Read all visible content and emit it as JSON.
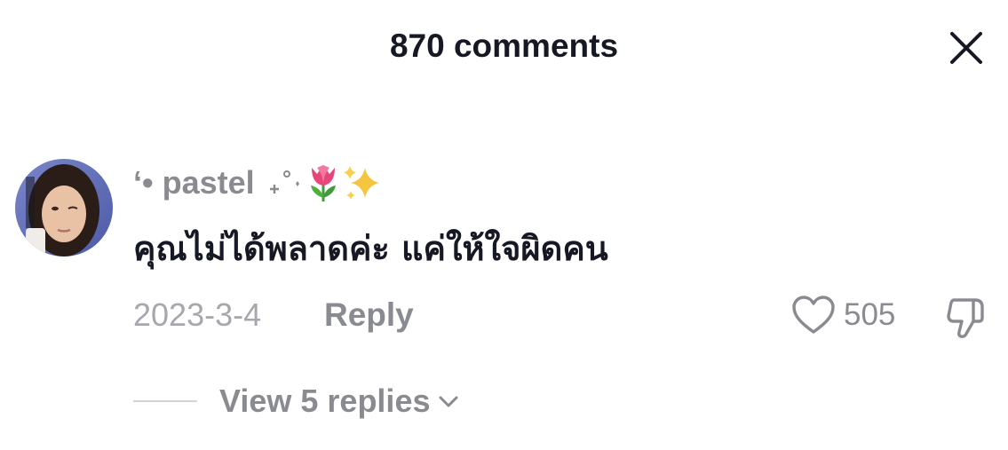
{
  "header": {
    "title": "870 comments"
  },
  "comment": {
    "username": "‘• pastel",
    "username_decoration_icons": [
      "sparkle-stars-icon",
      "tulip-emoji-icon",
      "sparkles-emoji-icon"
    ],
    "text": "คุณไม่ได้พลาดค่ะ แค่ให้ใจผิดคน",
    "date": "2023-3-4",
    "reply_label": "Reply",
    "like_count": "505"
  },
  "replies": {
    "label": "View 5 replies"
  },
  "colors": {
    "primary_text": "#161823",
    "secondary_text": "#8a8b91",
    "muted_text": "#a7a8ad",
    "divider": "#d3d3d6",
    "tulip": "#e8457a",
    "sparkle": "#f5c542"
  }
}
